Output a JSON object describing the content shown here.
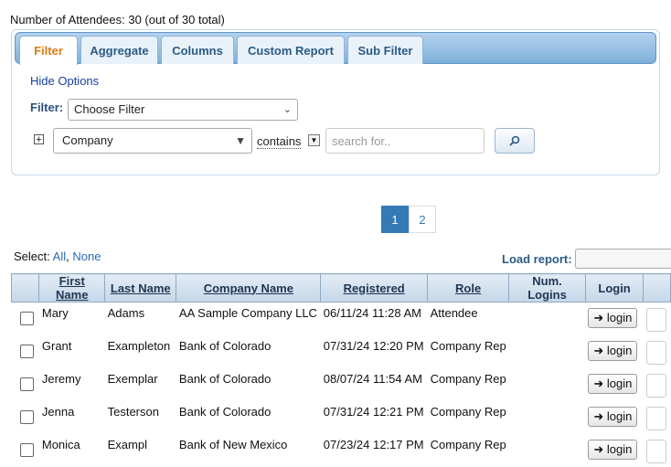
{
  "summary": "Number of Attendees: 30 (out of 30 total)",
  "tabs": [
    "Filter",
    "Aggregate",
    "Columns",
    "Custom Report",
    "Sub Filter"
  ],
  "filter": {
    "hide_options": "Hide Options",
    "label": "Filter:",
    "choose": "Choose Filter",
    "field": "Company",
    "operator": "contains",
    "search_placeholder": "search for.."
  },
  "pagination": [
    "1",
    "2"
  ],
  "select_links": {
    "label": "Select:",
    "all": "All",
    "none": "None"
  },
  "load_report": "Load report:",
  "columns": [
    "",
    "First Name",
    "Last Name",
    "Company Name",
    "Registered",
    "Role",
    "Num. Logins",
    "Login"
  ],
  "login_label": "login",
  "rows": [
    {
      "first": "Mary",
      "last": "Adams",
      "company": "AA Sample Company LLC",
      "registered": "06/11/24 11:28 AM",
      "role": "Attendee",
      "logins": ""
    },
    {
      "first": "Grant",
      "last": "Exampleton",
      "company": "Bank of Colorado",
      "registered": "07/31/24 12:20 PM",
      "role": "Company Rep",
      "logins": ""
    },
    {
      "first": "Jeremy",
      "last": "Exemplar",
      "company": "Bank of Colorado",
      "registered": "08/07/24 11:54 AM",
      "role": "Company Rep",
      "logins": ""
    },
    {
      "first": "Jenna",
      "last": "Testerson",
      "company": "Bank of Colorado",
      "registered": "07/31/24 12:21 PM",
      "role": "Company Rep",
      "logins": ""
    },
    {
      "first": "Monica",
      "last": "Exampl",
      "company": "Bank of New Mexico",
      "registered": "07/23/24 12:17 PM",
      "role": "Company Rep",
      "logins": ""
    }
  ]
}
